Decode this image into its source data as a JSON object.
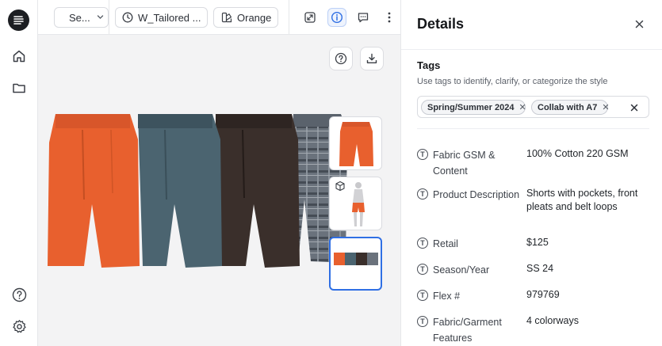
{
  "toolbar": {
    "select_label": "Se...",
    "version_label": "W_Tailored ...",
    "colorway_label": "Orange"
  },
  "details": {
    "title": "Details",
    "tags": {
      "title": "Tags",
      "help": "Use tags to identify, clarify, or categorize the style",
      "chips": [
        "Spring/Summer 2024",
        "Collab with A7"
      ]
    },
    "properties": [
      {
        "label": "Fabric GSM & Content",
        "value": "100% Cotton 220 GSM"
      },
      {
        "label": "Product Description",
        "value": "Shorts with pockets, front pleats and belt loops"
      },
      {
        "label": "Retail",
        "value": "$125"
      },
      {
        "label": "Season/Year",
        "value": "SS 24"
      },
      {
        "label": "Flex #",
        "value": "979769"
      },
      {
        "label": "Fabric/Garment Features",
        "value": "4 colorways"
      }
    ]
  },
  "colors": {
    "accent": "#2f6fe4",
    "orange": "#e8602e",
    "slate": "#4b6470",
    "brown": "#3a2f2b",
    "plaid": "#5c6570"
  }
}
